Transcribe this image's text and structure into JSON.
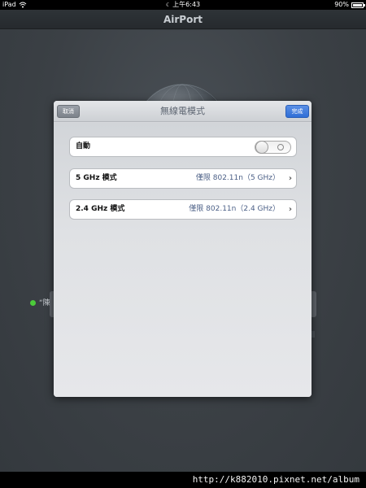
{
  "status_bar": {
    "device": "iPad",
    "time": "上午6:43",
    "battery": "90%"
  },
  "nav": {
    "title": "AirPort"
  },
  "background": {
    "status_fragment": "“陳"
  },
  "modal": {
    "title": "無線電模式",
    "cancel_label": "取消",
    "done_label": "完成",
    "rows": [
      {
        "label": "自動",
        "type": "toggle",
        "on": false
      },
      {
        "label": "5 GHz 模式",
        "value": "僅限 802.11n（5 GHz）"
      },
      {
        "label": "2.4 GHz 模式",
        "value": "僅限 802.11n（2.4 GHz）"
      }
    ]
  },
  "footer": {
    "watermark": "http://k882010.pixnet.net/album"
  },
  "colors": {
    "done_button": "#2f6ed6",
    "status_dot": "#4ccb3a",
    "detail_text": "#4b5f86"
  }
}
